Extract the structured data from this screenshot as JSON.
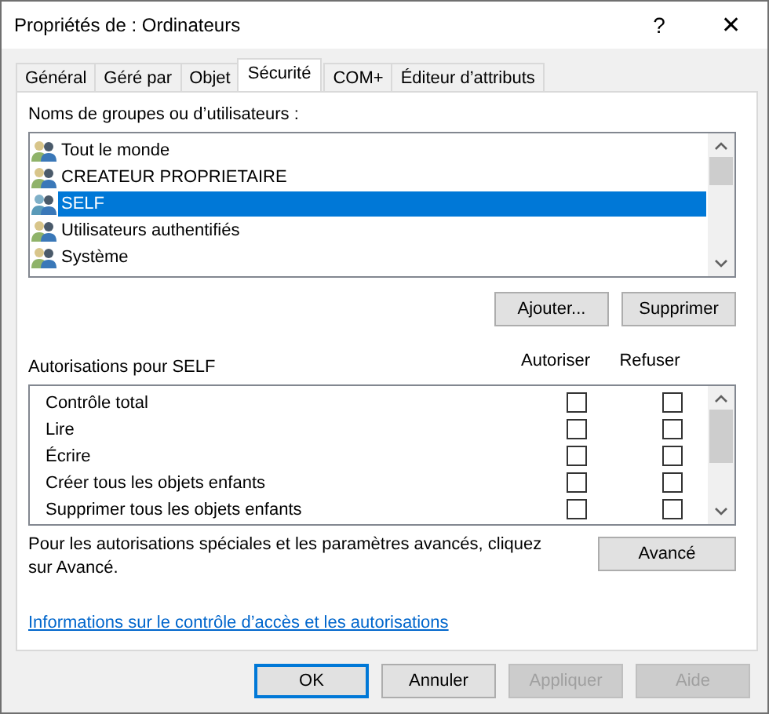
{
  "window": {
    "title": "Propriétés de : Ordinateurs",
    "help": "?",
    "close": "✕"
  },
  "tabs": [
    {
      "label": "Général",
      "selected": false
    },
    {
      "label": "Géré par",
      "selected": false
    },
    {
      "label": "Objet",
      "selected": false
    },
    {
      "label": "Sécurité",
      "selected": true
    },
    {
      "label": "COM+",
      "selected": false
    },
    {
      "label": "Éditeur d’attributs",
      "selected": false
    }
  ],
  "groups": {
    "label": "Noms de groupes ou d’utilisateurs :",
    "items": [
      {
        "name": "Tout le monde",
        "selected": false
      },
      {
        "name": "CREATEUR PROPRIETAIRE",
        "selected": false
      },
      {
        "name": "SELF",
        "selected": true
      },
      {
        "name": "Utilisateurs authentifiés",
        "selected": false
      },
      {
        "name": "Système",
        "selected": false
      }
    ],
    "buttons": [
      "Ajouter...",
      "Supprimer"
    ]
  },
  "permissions": {
    "label": "Autorisations pour SELF",
    "columns": [
      "Autoriser",
      "Refuser"
    ],
    "rows": [
      {
        "name": "Contrôle total",
        "allow": false,
        "deny": false
      },
      {
        "name": "Lire",
        "allow": false,
        "deny": false
      },
      {
        "name": "Écrire",
        "allow": false,
        "deny": false
      },
      {
        "name": "Créer tous les objets enfants",
        "allow": false,
        "deny": false
      },
      {
        "name": "Supprimer tous les objets enfants",
        "allow": false,
        "deny": false
      }
    ]
  },
  "advanced": {
    "text": "Pour les autorisations spéciales et les paramètres avancés, cliquez sur Avancé.",
    "button": "Avancé"
  },
  "link": "Informations sur le contrôle d’accès et les autorisations",
  "footer_buttons": [
    {
      "label": "OK",
      "default": true,
      "disabled": false
    },
    {
      "label": "Annuler",
      "default": false,
      "disabled": false
    },
    {
      "label": "Appliquer",
      "default": false,
      "disabled": true
    },
    {
      "label": "Aide",
      "default": false,
      "disabled": true
    }
  ]
}
